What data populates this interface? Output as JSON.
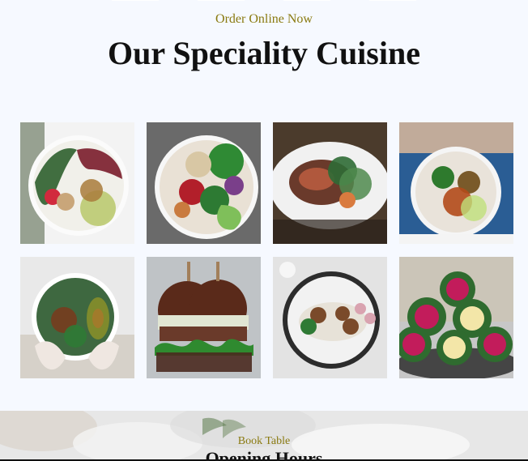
{
  "top_nav": {
    "items": [
      "",
      "",
      "",
      ""
    ]
  },
  "hero": {
    "kicker": "Order Online Now",
    "title": "Our Speciality Cuisine"
  },
  "gallery": {
    "items": [
      {
        "name": "beet-greens-bowl",
        "palette": [
          "#f3f3f3",
          "#2d5f2d",
          "#7a1c2b",
          "#a97b3b",
          "#c2c86a"
        ]
      },
      {
        "name": "chickpea-avocado-bowl",
        "palette": [
          "#6a6a6a",
          "#2f8a34",
          "#b21f2a",
          "#d8c7a4",
          "#7a3f8a"
        ]
      },
      {
        "name": "stuffed-roast-plate",
        "palette": [
          "#4b3b2c",
          "#f1f1f1",
          "#6a3a2b",
          "#d97b3f",
          "#2f6b35"
        ]
      },
      {
        "name": "buddha-bowl-hands",
        "palette": [
          "#1b4a86",
          "#d1b49a",
          "#2e7a2d",
          "#b24a1a",
          "#f4f4f4"
        ]
      },
      {
        "name": "avocado-bowl-hands",
        "palette": [
          "#e9e9e9",
          "#1c4d1f",
          "#7f8a2c",
          "#7a3a1c",
          "#d6d1c9"
        ]
      },
      {
        "name": "veggie-burgers",
        "palette": [
          "#bfc3c6",
          "#5a2a1a",
          "#2f8a2f",
          "#e1e6d3",
          "#a27f5a"
        ]
      },
      {
        "name": "noodle-bowl",
        "palette": [
          "#e3e3e3",
          "#2c2c2c",
          "#7a4a2a",
          "#e7e2d8",
          "#2f7a35"
        ]
      },
      {
        "name": "cabbage-wraps",
        "palette": [
          "#c7c7c7",
          "#2f6b2f",
          "#c21c5b",
          "#f3e6a8",
          "#1a1a1a"
        ]
      }
    ]
  },
  "booking": {
    "kicker": "Book Table",
    "title": "Opening Hours"
  },
  "colors": {
    "background": "#f6f9ff",
    "accent_kicker": "#8a7a10",
    "heading": "#111111"
  }
}
